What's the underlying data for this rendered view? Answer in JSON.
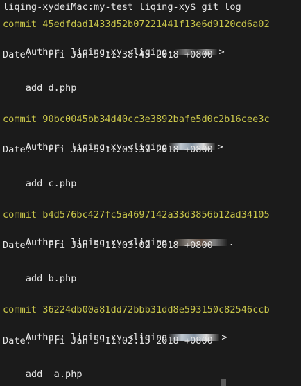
{
  "terminal": {
    "prompt": "liqing-xydeiMac:my-test liqing-xy$ git log",
    "commits": [
      {
        "hash_line": "commit 45edfdad1433d52b07221441f13e6d9120cd6a02",
        "author_prefix": "Author: liqing-xy <liqing-",
        "author_suffix": ">",
        "date_line": "Date:   Fri Jan 5 11:38:45 2018 +0800",
        "message": "    add d.php"
      },
      {
        "hash_line": "commit 90bc0045bb34d40cc3e3892bafe5d0c2b16cee3c",
        "author_prefix": "Author: liqing-xy <liqing",
        "author_suffix": ">",
        "date_line": "Date:   Fri Jan 5 11:03:37 2018 +0800",
        "message": "    add c.php"
      },
      {
        "hash_line": "commit b4d576bc427fc5a4697142a33d3856b12ad34105",
        "author_prefix": "Author: liqing-xy <liqing-",
        "author_suffix": ".",
        "date_line": "Date:   Fri Jan 5 11:03:02 2018 +0800",
        "message": "    add b.php"
      },
      {
        "hash_line": "commit 36224db00a81dd72bbb31dd8e593150c82546ccb",
        "author_prefix": "Author: liqing-xy <liqing",
        "author_suffix": ">",
        "date_line": "Date:   Fri Jan 5 11:02:15 2018 +0800",
        "message": "    add  a.php"
      }
    ]
  }
}
